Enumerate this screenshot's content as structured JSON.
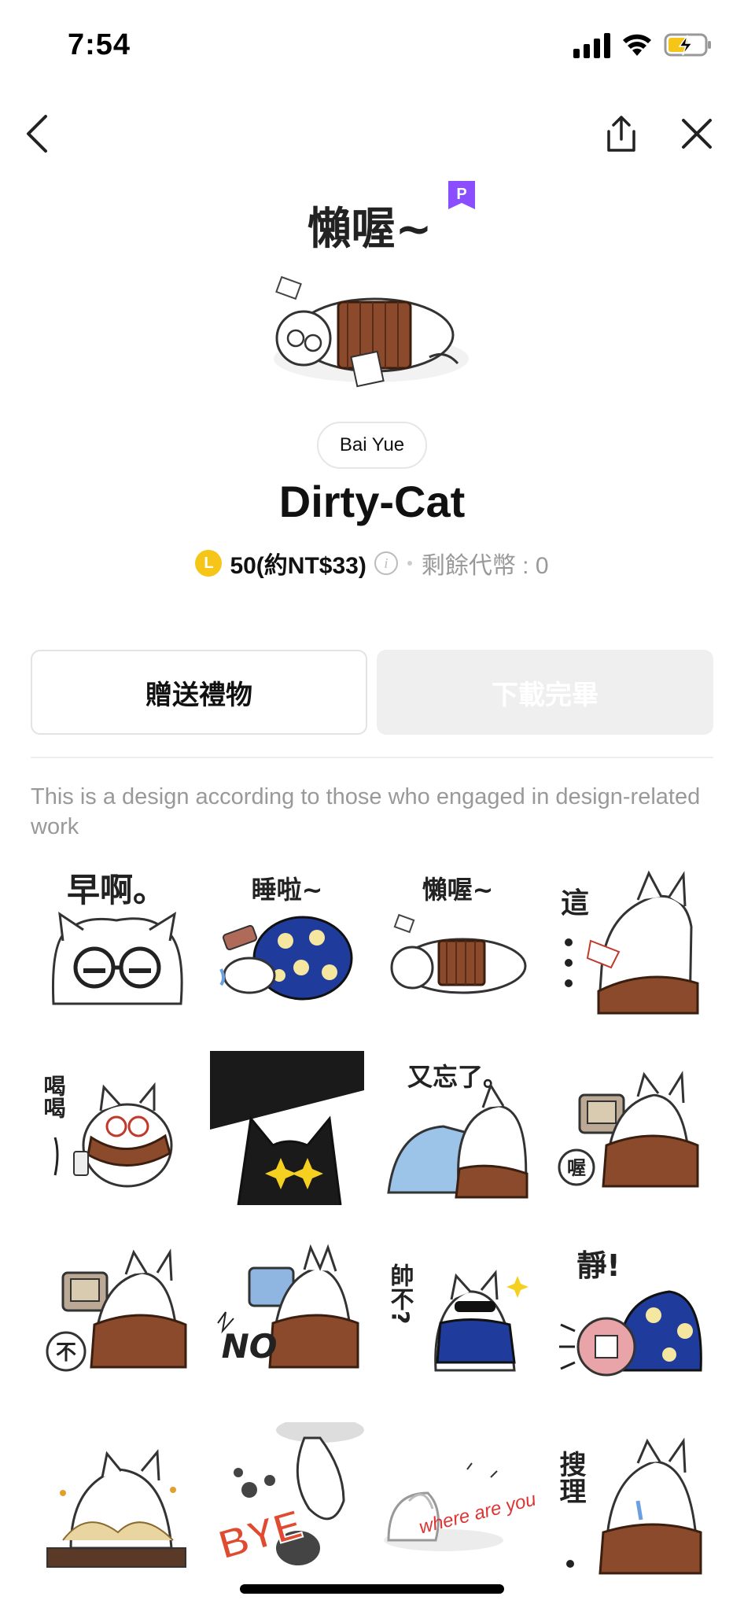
{
  "status_bar": {
    "time": "7:54"
  },
  "product": {
    "author": "Bai Yue",
    "title": "Dirty-Cat",
    "coin_symbol": "L",
    "price": "50(約NT$33)",
    "balance": "剩餘代幣 : 0",
    "premium_badge": "P",
    "hero_text": "懶喔~"
  },
  "buttons": {
    "gift": "贈送禮物",
    "download": "下載完畢"
  },
  "description": "This is a design according to those who engaged in design-related work",
  "stickers": [
    {
      "caption": "早啊。"
    },
    {
      "caption": "睡啦~"
    },
    {
      "caption": "懶喔~"
    },
    {
      "caption": "這"
    },
    {
      "caption": "喝喝"
    },
    {
      "caption": ""
    },
    {
      "caption": "又忘了。"
    },
    {
      "caption": "喔"
    },
    {
      "caption": "不"
    },
    {
      "caption": "NO"
    },
    {
      "caption": "帥不?"
    },
    {
      "caption": "靜!"
    },
    {
      "caption": ""
    },
    {
      "caption": "BYE"
    },
    {
      "caption": "where are you??"
    },
    {
      "caption": "搜理"
    }
  ],
  "colors": {
    "coin": "#f5c518",
    "premium": "#8a4dff",
    "scarf": "#8b4a2b",
    "blanket": "#1f3b9c"
  },
  "icons": [
    "back-icon",
    "share-icon",
    "close-icon",
    "info-icon",
    "signal-icon",
    "wifi-icon",
    "battery-icon"
  ]
}
